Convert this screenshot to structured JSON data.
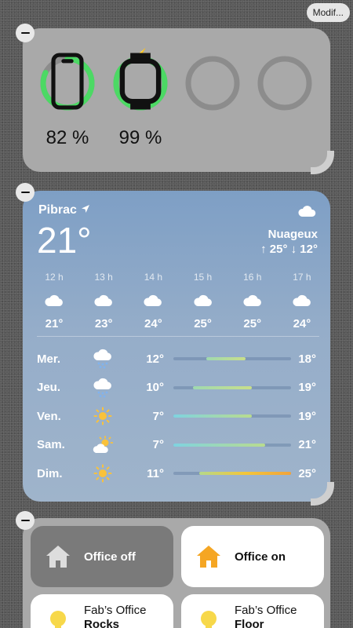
{
  "toolbar": {
    "modify_label": "Modif..."
  },
  "batteries": {
    "devices": [
      {
        "device": "phone",
        "percent_value": 82,
        "percent_label": "82 %",
        "charging": false
      },
      {
        "device": "watch",
        "percent_value": 99,
        "percent_label": "99 %",
        "charging": true
      },
      {
        "device": "empty",
        "percent_value": null,
        "percent_label": ""
      },
      {
        "device": "empty",
        "percent_value": null,
        "percent_label": ""
      }
    ],
    "ring_color": "#4cd964"
  },
  "weather": {
    "city": "Pibrac",
    "current_temp": "21°",
    "condition": "Nuageux",
    "hi_lo": "↑ 25° ↓ 12°",
    "hourly": [
      {
        "time": "12 h",
        "icon": "cloud-icon",
        "temp": "21°"
      },
      {
        "time": "13 h",
        "icon": "cloud-icon",
        "temp": "23°"
      },
      {
        "time": "14 h",
        "icon": "cloud-icon",
        "temp": "24°"
      },
      {
        "time": "15 h",
        "icon": "cloud-icon",
        "temp": "25°"
      },
      {
        "time": "16 h",
        "icon": "cloud-icon",
        "temp": "25°"
      },
      {
        "time": "17 h",
        "icon": "cloud-icon",
        "temp": "24°"
      }
    ],
    "daily": [
      {
        "day": "Mer.",
        "icon": "cloud-rain-icon",
        "min": "12°",
        "max": "18°",
        "range": [
          12,
          18
        ]
      },
      {
        "day": "Jeu.",
        "icon": "cloud-rain-icon",
        "min": "10°",
        "max": "19°",
        "range": [
          10,
          19
        ]
      },
      {
        "day": "Ven.",
        "icon": "sun-icon",
        "min": "7°",
        "max": "19°",
        "range": [
          7,
          19
        ]
      },
      {
        "day": "Sam.",
        "icon": "partly-cloudy-icon",
        "min": "7°",
        "max": "21°",
        "range": [
          7,
          21
        ]
      },
      {
        "day": "Dim.",
        "icon": "sun-icon",
        "min": "11°",
        "max": "25°",
        "range": [
          11,
          25
        ]
      }
    ],
    "week_range": [
      7,
      25
    ]
  },
  "home": {
    "tiles": [
      {
        "label": "Office off",
        "icon": "house-icon",
        "state": "off"
      },
      {
        "label": "Office on",
        "icon": "house-icon",
        "state": "on"
      },
      {
        "line1": "Fab’s Office",
        "line2": "Rocks",
        "icon": "bulb-icon"
      },
      {
        "line1": "Fab’s Office",
        "line2": "Floor",
        "icon": "bulb-icon"
      }
    ]
  }
}
